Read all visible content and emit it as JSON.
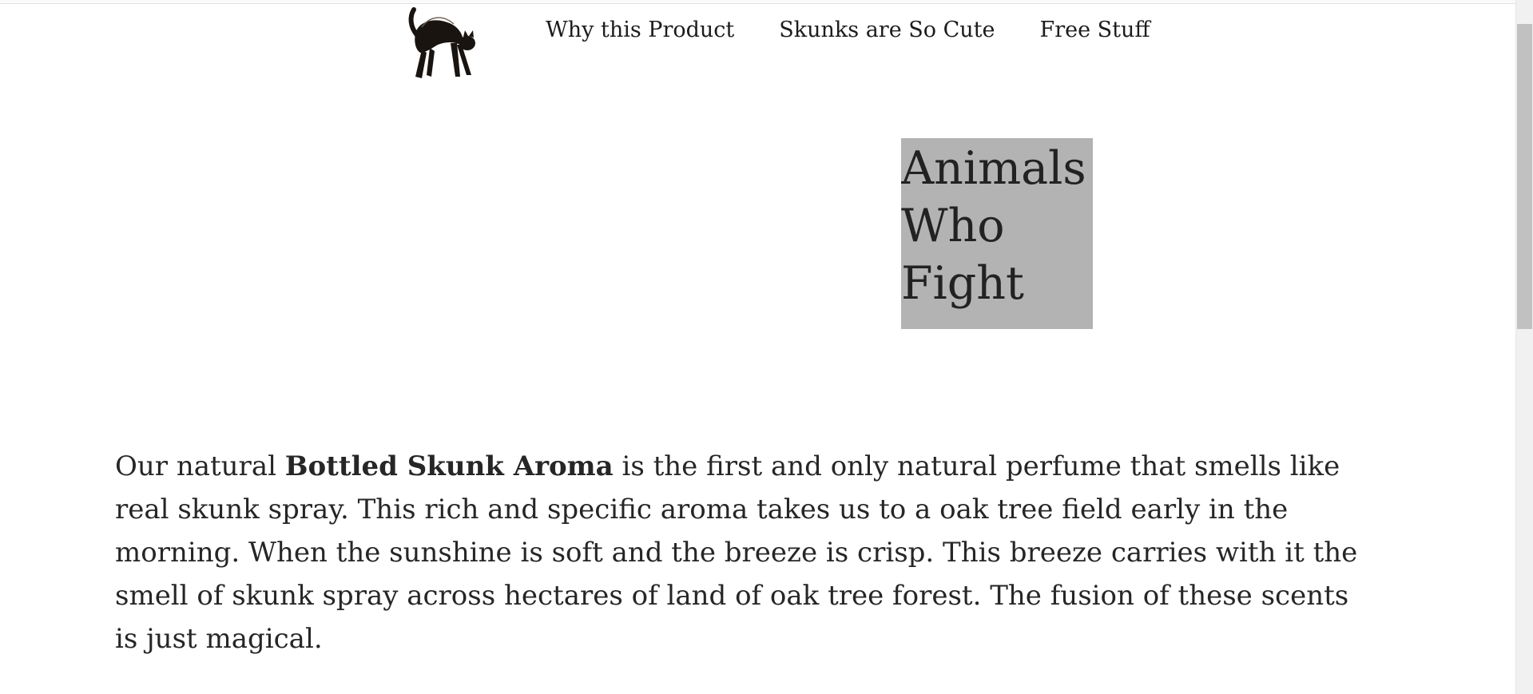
{
  "nav": {
    "items": [
      {
        "label": "Why this Product"
      },
      {
        "label": "Skunks are So Cute"
      },
      {
        "label": "Free Stuff"
      }
    ]
  },
  "logo": {
    "icon": "black-cat-icon"
  },
  "hero": {
    "lines": [
      "Animals",
      "Who",
      "Fight"
    ],
    "background": "#b3b3b3"
  },
  "intro": {
    "prefix": "Our natural ",
    "product_name": "Bottled Skunk Aroma",
    "suffix": " is the first and only natural perfume that smells like real skunk spray. This rich and specific aroma takes us to a oak tree field early in the morning. When the sunshine is soft and the breeze is crisp. This breeze carries with it the smell of skunk spray across hectares of land of oak tree forest. The fusion of these scents is just magical."
  }
}
